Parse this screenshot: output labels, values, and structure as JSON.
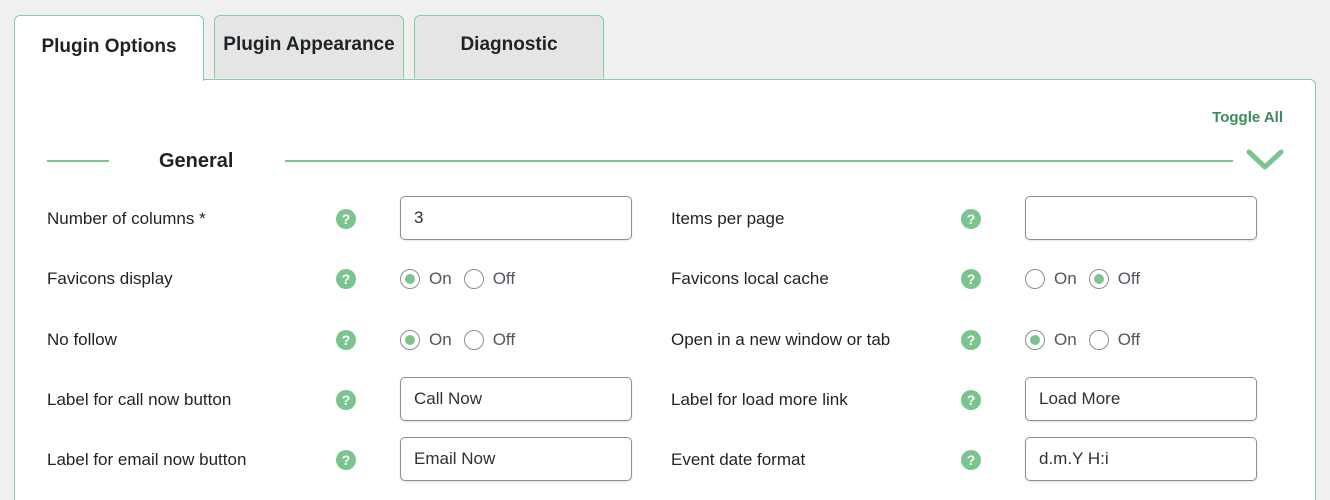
{
  "tabs": [
    {
      "label": "Plugin Options",
      "active": true
    },
    {
      "label": "Plugin Appearance",
      "active": false
    },
    {
      "label": "Diagnostic",
      "active": false
    }
  ],
  "toggle_all": "Toggle All",
  "section": {
    "title": "General",
    "collapse_icon": "chevron-down-icon"
  },
  "help_icon_glyph": "?",
  "colors": {
    "accent": "#7bc48f",
    "border": "#7ad3a0",
    "link": "#3b8a5c"
  },
  "fields": {
    "number_of_columns": {
      "label": "Number of columns *",
      "value": "3"
    },
    "items_per_page": {
      "label": "Items per page",
      "value": ""
    },
    "favicons_display": {
      "label": "Favicons display",
      "on": "On",
      "off": "Off",
      "selected": "On"
    },
    "favicons_local_cache": {
      "label": "Favicons local cache",
      "on": "On",
      "off": "Off",
      "selected": "Off"
    },
    "no_follow": {
      "label": "No follow",
      "on": "On",
      "off": "Off",
      "selected": "On"
    },
    "open_new_window": {
      "label": "Open in a new window or tab",
      "on": "On",
      "off": "Off",
      "selected": "On"
    },
    "label_call_now": {
      "label": "Label for call now button",
      "value": "Call Now"
    },
    "label_load_more": {
      "label": "Label for load more link",
      "value": "Load More"
    },
    "label_email_now": {
      "label": "Label for email now button",
      "value": "Email Now"
    },
    "event_date_format": {
      "label": "Event date format",
      "value": "d.m.Y H:i"
    }
  }
}
